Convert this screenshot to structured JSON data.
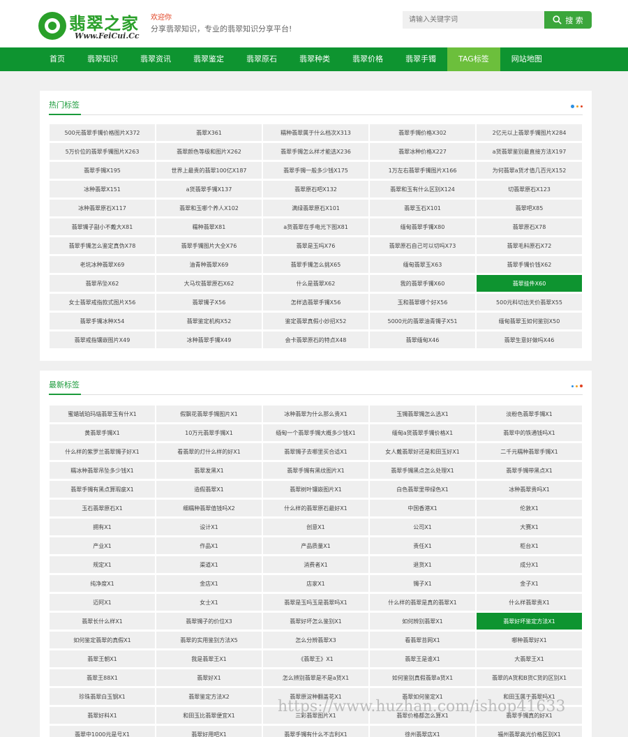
{
  "header": {
    "logo_text": "翡翠之家",
    "logo_url": "Www.FeiCui.Cc",
    "welcome": "欢迎你",
    "slogan": "分享翡翠知识，专业的翡翠知识分享平台!",
    "search_placeholder": "请输入关键字词",
    "search_button": "搜 索"
  },
  "nav": {
    "items": [
      "首页",
      "翡翠知识",
      "翡翠资讯",
      "翡翠鉴定",
      "翡翠原石",
      "翡翠种类",
      "翡翠价格",
      "翡翠手镯",
      "TAG标签",
      "网站地图"
    ],
    "active": "TAG标签"
  },
  "hot": {
    "title": "热门标签",
    "highlighted": "翡翠挂件X60",
    "tags": [
      "500元翡翠手镯价格图片X372",
      "翡翠X361",
      "糯种翡翠属于什么档次X313",
      "翡翠手镯价格X302",
      "2亿元以上翡翠手镯图片X284",
      "5万价位的翡翠手镯图片X263",
      "翡翠颜色等级和图片X262",
      "翡翠手镯怎么样才能选X236",
      "翡翠冰种价格X227",
      "a货翡翠鉴别最直接方法X197",
      "翡翠手镯X195",
      "世界上最贵的翡翠100亿X187",
      "翡翠手镯一般多少钱X175",
      "1万左右翡翠手镯图片X166",
      "为何翡翠a货才值几百元X152",
      "冰种翡翠X151",
      "a货翡翠手镯X137",
      "翡翠原石吧X132",
      "翡翠和玉有什么区别X124",
      "切翡翠原石X123",
      "冰种翡翠原石X117",
      "翡翠和玉哪个养人X102",
      "满绿翡翠原石X101",
      "翡翠玉石X101",
      "翡翠吧X85",
      "翡翠镯子副小不戴大X81",
      "糯种翡翠X81",
      "a货翡翠在手电光下图X81",
      "缅甸翡翠手镯X80",
      "翡翠原石X78",
      "翡翠手镯怎么鉴定真伪X78",
      "翡翠手镯图片大全X76",
      "翡翠是玉吗X76",
      "翡翠原石自己可以切吗X73",
      "翡翠毛料原石X72",
      "老坑冰种翡翠X69",
      "油青种翡翠X69",
      "翡翠手镯怎么挑X65",
      "缅甸翡翠玉X63",
      "翡翠手镯价钱X62",
      "翡翠吊坠X62",
      "大马坎翡翠原石X62",
      "什么是翡翠X62",
      "我的翡翠手镯X60",
      "翡翠挂件X60",
      "女士翡翠戒指款式图片X56",
      "翡翠镯子X56",
      "怎样选翡翠手镯X56",
      "玉和翡翠哪个好X56",
      "500元料切出天价翡翠X55",
      "翡翠手镯冰种X54",
      "翡翠鉴定机构X52",
      "鉴定翡翠真假小妙招X52",
      "5000元的翡翠油青镯子X51",
      "缅甸翡翠玉如何鉴别X50",
      "翡翠戒指镶嵌图片X49",
      "冰种翡翠手镯X49",
      "会卡翡翠原石的特点X48",
      "翡翠缅甸X46",
      "翡翠生意好做吗X46"
    ]
  },
  "latest": {
    "title": "最新标签",
    "highlighted": "翡翠好坏鉴定方法X1",
    "tags": [
      "蜜蜡琥珀玛瑙翡翠玉有什X1",
      "假飘花翡翠手镯图片X1",
      "冰种翡翠为什么那么贵X1",
      "玉镯翡翠镯怎么选X1",
      "淡粉色翡翠手镯X1",
      "黄翡翠手镯X1",
      "10万元翡翠手镯X1",
      "缅甸一个翡翠手镯大概多少钱X1",
      "缅甸a货翡翠手镯价格X1",
      "翡翠中的铁通钱吗X1",
      "什么样的紫罗兰翡翠镯子好X1",
      "看翡翠的灯什么样的好X1",
      "翡翠镯子去哪里买合适X1",
      "女人戴翡翠好还是和田玉好X1",
      "二千元糯种翡翠手镯X1",
      "糯冰种翡翠吊坠多少钱X1",
      "翡翠发黑X1",
      "翡翠手镯有黑纹图片X1",
      "翡翠手镯黑点怎么处理X1",
      "翡翠手镯带黑点X1",
      "翡翠手镯有黑点算瑕疵X1",
      "造假翡翠X1",
      "翡翠树叶镶嵌图片X1",
      "白色翡翠里带绿色X1",
      "冰种翡翠贵吗X1",
      "玉石翡翠原石X1",
      "细糯种翡翠值钱吗X2",
      "什么样的翡翠原石最好X1",
      "中国香港X1",
      "伦敦X1",
      "拥有X1",
      "设计X1",
      "创意X1",
      "公司X1",
      "大赛X1",
      "产业X1",
      "作品X1",
      "产品质量X1",
      "责任X1",
      "柜台X1",
      "规定X1",
      "渠道X1",
      "消费者X1",
      "退货X1",
      "成分X1",
      "纯净度X1",
      "金店X1",
      "店家X1",
      "镯子X1",
      "金子X1",
      "迈阿X1",
      "女士X1",
      "翡翠是玉吗玉是翡翠吗X1",
      "什么样的翡翠是真的翡翠X1",
      "什么样翡翠贵X1",
      "翡翠长什么样X1",
      "翡翠镯子的价位X3",
      "翡翠好坏怎么鉴别X1",
      "如何辨别翡翠X1",
      "翡翠好坏鉴定方法X1",
      "如何鉴定翡翠的真假X1",
      "翡翠的实用鉴别方法X5",
      "怎么分辨翡翠X3",
      "看翡翠苔网X1",
      "哪种翡翠好X1",
      "翡翠王朝X1",
      "我是翡翠王X1",
      "《翡翠王》X1",
      "翡翠王是谁X1",
      "大翡翠王X1",
      "翡翠王88X1",
      "翡翠好X1",
      "怎么辨别翡翠是不是a货X1",
      "如何鉴别真假翡翠a货X1",
      "翡翠的A货和B货C货的区别X1",
      "珍珠翡翠白玉钢X1",
      "翡翠鉴定方法X2",
      "翡翠原淀种翻盖花X1",
      "翡翠如何鉴定X1",
      "和田玉属于翡翠吗X1",
      "翡翠好料X1",
      "和田玉比翡翠便宜X1",
      "三彩翡翠图片X1",
      "翡翠价格都怎么算X1",
      "翡翠手镯真的好X1",
      "翡翠中1000元是号X1",
      "翡翠好用吧X1",
      "翡翠手镯有什么不吉利X1",
      "徐州翡翠店X1",
      "福州翡翠高光价格区别X1"
    ]
  },
  "watermark": "https://www.huzhan.com/ishop41633",
  "colors": {
    "brand_green": "#0e9430",
    "nav_active": "#6cbf3c",
    "tag_bg": "#efefef",
    "accent_red": "#e04020"
  }
}
